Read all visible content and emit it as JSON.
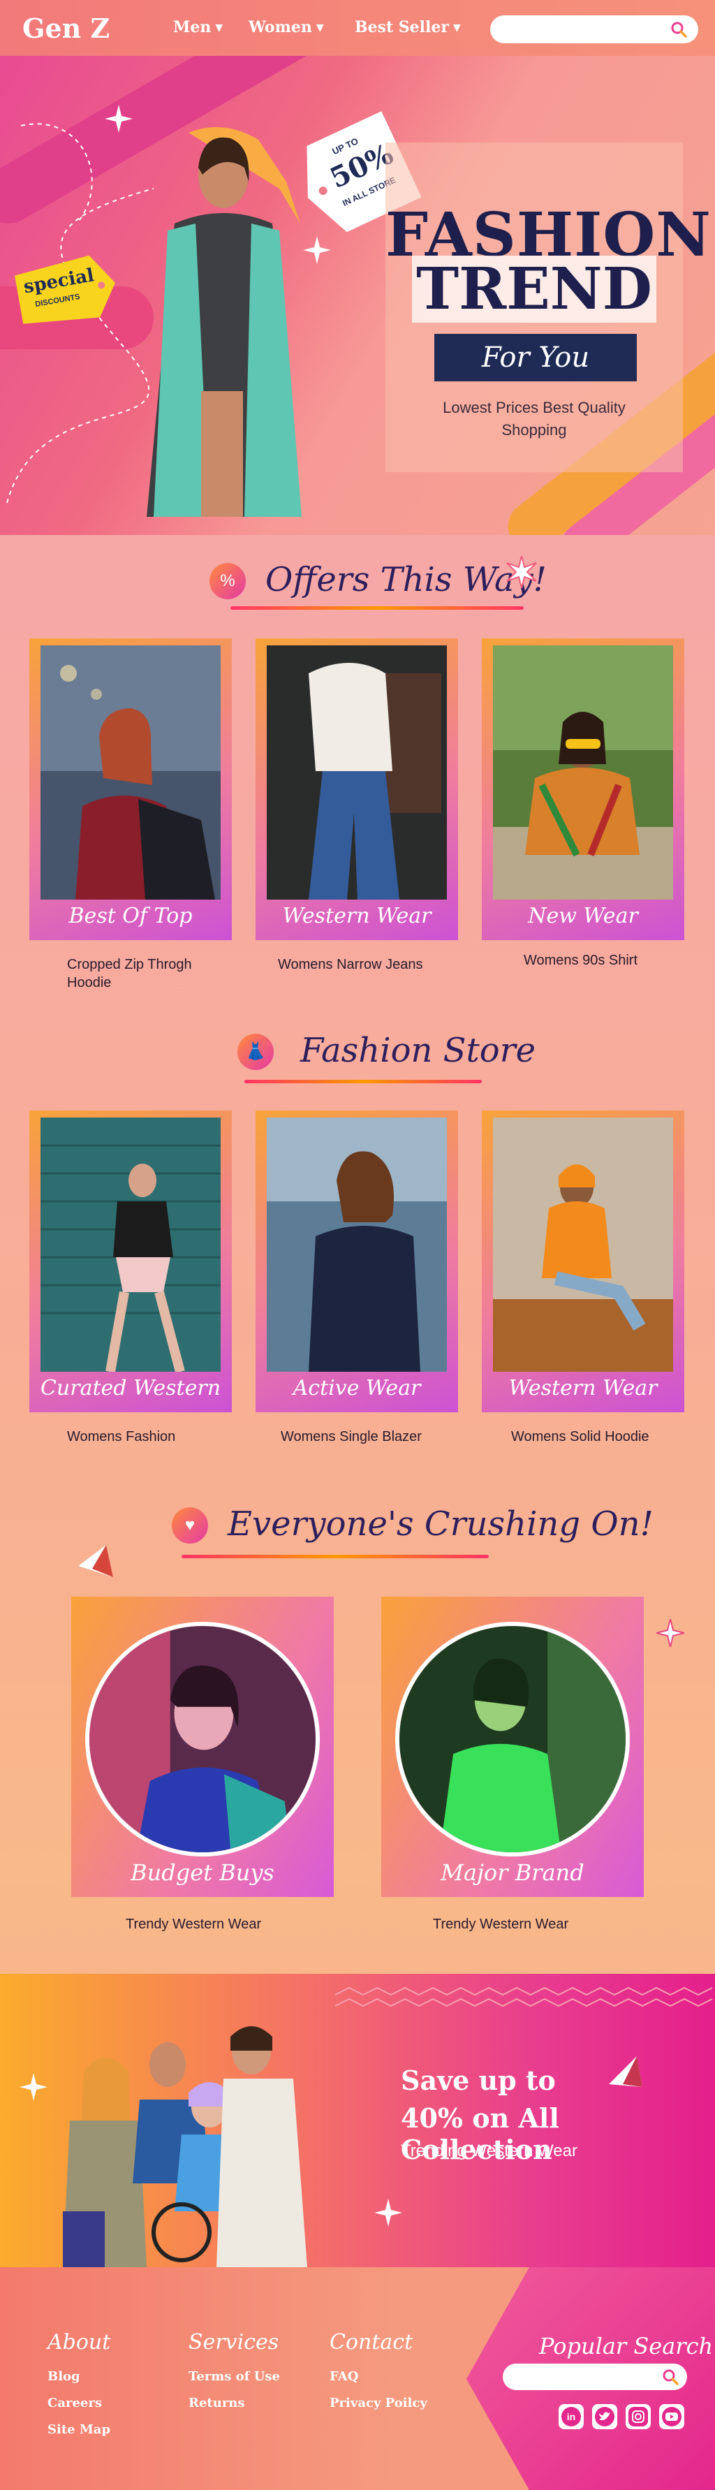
{
  "nav": {
    "brand": "Gen Z",
    "items": [
      {
        "label": "Men"
      },
      {
        "label": "Women"
      },
      {
        "label": "Best Seller"
      }
    ],
    "search_placeholder": ""
  },
  "hero": {
    "title_line1": "FASHION",
    "title_line2": "TREND",
    "button_label": "For You",
    "subtitle_line1": "Lowest Prices Best Quality",
    "subtitle_line2": "Shopping",
    "tag_special": "special",
    "tag_special_sub": "DISCOUNTS",
    "tag_upto": "UP TO",
    "tag_percent": "50%",
    "tag_store": "IN ALL STORE"
  },
  "offers": {
    "title": "Offers This Way!",
    "icon_glyph": "%",
    "cards": [
      {
        "label": "Best Of Top",
        "caption_line1": "Cropped Zip Throgh",
        "caption_line2": "Hoodie"
      },
      {
        "label": "Western Wear",
        "caption_line1": "Womens Narrow Jeans",
        "caption_line2": ""
      },
      {
        "label": "New Wear",
        "caption_line1": "Womens 90s Shirt",
        "caption_line2": ""
      }
    ]
  },
  "store": {
    "title": "Fashion Store",
    "cards": [
      {
        "label": "Curated Western",
        "caption": "Womens Fashion"
      },
      {
        "label": "Active Wear",
        "caption": "Womens Single Blazer"
      },
      {
        "label": "Western Wear",
        "caption": "Womens Solid Hoodie"
      }
    ]
  },
  "crushing": {
    "title": "Everyone's Crushing On!",
    "cards": [
      {
        "label": "Budget Buys",
        "caption": "Trendy Western Wear"
      },
      {
        "label": "Major Brand",
        "caption": "Trendy Western Wear"
      }
    ]
  },
  "promo": {
    "line1": "Save up to",
    "line2": "40% on All Collection",
    "sub": "Trending Western Wear"
  },
  "footer": {
    "about": {
      "title": "About",
      "links": [
        "Blog",
        "Careers",
        "Site Map"
      ]
    },
    "services": {
      "title": "Services",
      "links": [
        "Terms of Use",
        "Returns"
      ]
    },
    "contact": {
      "title": "Contact",
      "links": [
        "FAQ",
        "Privacy Poilcy"
      ]
    },
    "popular_title": "Popular Search",
    "search_placeholder": "",
    "social": [
      "linkedin-icon",
      "twitter-icon",
      "instagram-icon",
      "youtube-icon"
    ]
  },
  "colors": {
    "navy": "#1f2a55",
    "pink": "#e4278c",
    "orange": "#f9a23a"
  }
}
